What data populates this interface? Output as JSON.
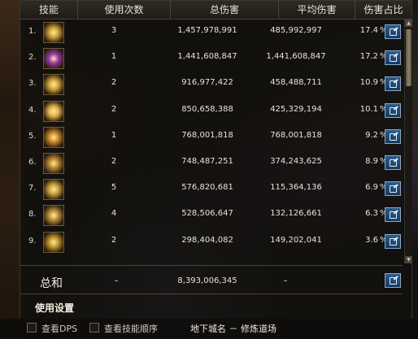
{
  "header": {
    "skill": "技能",
    "uses": "使用次数",
    "total_damage": "总伤害",
    "avg_damage": "平均伤害",
    "damage_share": "伤害占比"
  },
  "rows": [
    {
      "index": "1.",
      "uses": "3",
      "total": "1,457,978,991",
      "avg": "485,992,997",
      "pct": "17.4",
      "sign": "%",
      "icon": "golden-crown-icon",
      "icon_color": "#c9a23a"
    },
    {
      "index": "2.",
      "uses": "1",
      "total": "1,441,608,847",
      "avg": "1,441,608,847",
      "pct": "17.2",
      "sign": "%",
      "icon": "purple-burst-icon",
      "icon_color": "#9a3aa8"
    },
    {
      "index": "3.",
      "uses": "2",
      "total": "916,977,422",
      "avg": "458,488,711",
      "pct": "10.9",
      "sign": "%",
      "icon": "golden-slash-icon",
      "icon_color": "#d1a43a"
    },
    {
      "index": "4.",
      "uses": "2",
      "total": "850,658,388",
      "avg": "425,329,194",
      "pct": "10.1",
      "sign": "%",
      "icon": "golden-flower-icon",
      "icon_color": "#e0b347"
    },
    {
      "index": "5.",
      "uses": "1",
      "total": "768,001,818",
      "avg": "768,001,818",
      "pct": "9.2",
      "sign": "%",
      "icon": "golden-sunburst-icon",
      "icon_color": "#c9892a"
    },
    {
      "index": "6.",
      "uses": "2",
      "total": "748,487,251",
      "avg": "374,243,625",
      "pct": "8.9",
      "sign": "%",
      "icon": "golden-claws-icon",
      "icon_color": "#b8862e"
    },
    {
      "index": "7.",
      "uses": "5",
      "total": "576,820,681",
      "avg": "115,364,136",
      "pct": "6.9",
      "sign": "%",
      "icon": "golden-strike-icon",
      "icon_color": "#caa03c"
    },
    {
      "index": "8.",
      "uses": "4",
      "total": "528,506,647",
      "avg": "132,126,661",
      "pct": "6.3",
      "sign": "%",
      "icon": "golden-dash-icon",
      "icon_color": "#b88f3a"
    },
    {
      "index": "9.",
      "uses": "2",
      "total": "298,404,082",
      "avg": "149,202,041",
      "pct": "3.6",
      "sign": "%",
      "icon": "golden-swirl-icon",
      "icon_color": "#c2962e"
    }
  ],
  "total": {
    "label": "总和",
    "uses": "–",
    "total": "8,393,006,345",
    "avg": "–"
  },
  "settings_label": "使用设置",
  "bottom": {
    "show_dps": "查看DPS",
    "show_skill_order": "查看技能顺序",
    "dungeon_label": "地下城名 － 修炼道场"
  },
  "accent": "#2c5c8c"
}
